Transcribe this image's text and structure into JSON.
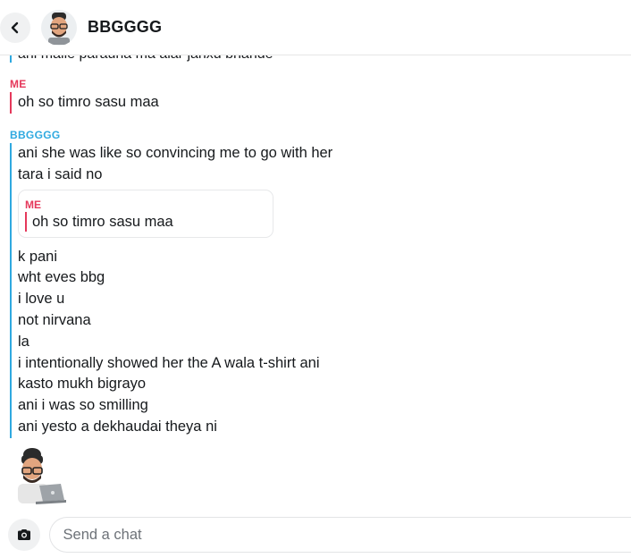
{
  "header": {
    "contact_name": "BBGGGG",
    "back_icon": "chevron-left-icon",
    "avatar_icon": "bitmoji-avatar"
  },
  "messages": {
    "clipped_line": "ani malle parauna ma alar janxu bhande",
    "groups": [
      {
        "sender": "ME",
        "side": "me",
        "lines": [
          "oh so timro sasu maa"
        ]
      },
      {
        "sender": "BBGGGG",
        "side": "bb",
        "lines_before_quote": [
          "ani she was like so convincing me to go with her",
          "tara i said no"
        ],
        "quote": {
          "sender": "ME",
          "text": "oh so timro sasu maa"
        },
        "lines_after_quote": [
          "k pani",
          "wht eves bbg",
          "i love u",
          "not nirvana",
          "la",
          "i intentionally showed her the A wala t-shirt ani",
          "kasto mukh bigrayo",
          "ani i was so smilling",
          "ani yesto a dekhaudai theya ni"
        ]
      }
    ],
    "typing_bitmoji": "bitmoji-on-laptop"
  },
  "composer": {
    "camera_icon": "camera-icon",
    "placeholder": "Send a chat"
  },
  "colors": {
    "me_accent": "#e5385b",
    "friend_accent": "#2fa9e0",
    "text": "#16191c"
  }
}
